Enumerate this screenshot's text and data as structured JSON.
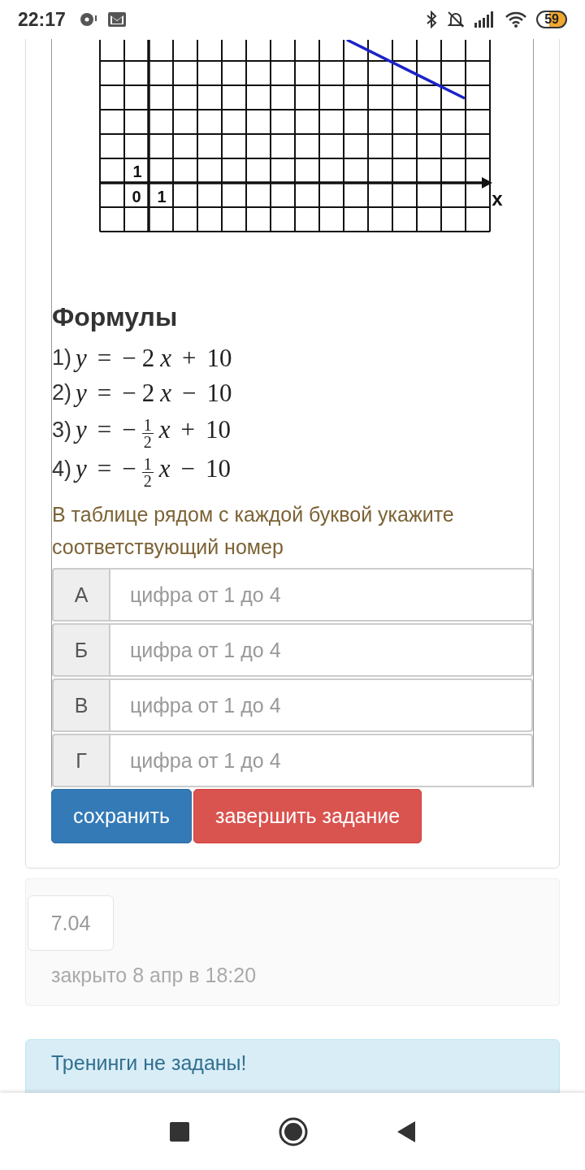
{
  "status_bar": {
    "time": "22:17",
    "battery": "59"
  },
  "graph": {
    "labels": [
      {
        "kind": "y_unit",
        "text": "1"
      },
      {
        "kind": "origin",
        "text": "0"
      },
      {
        "kind": "x_unit",
        "text": "1"
      },
      {
        "kind": "x_axis",
        "text": "x"
      }
    ]
  },
  "heading": "Формулы",
  "formulas": [
    {
      "label": "1)",
      "lhs": "y",
      "relation": "=",
      "kind": "integer",
      "sign": "−",
      "coef": "2",
      "variable": "x",
      "op": "+",
      "constant": "10"
    },
    {
      "label": "2)",
      "lhs": "y",
      "relation": "=",
      "kind": "integer",
      "sign": "−",
      "coef": "2",
      "variable": "x",
      "op": "−",
      "constant": "10"
    },
    {
      "label": "3)",
      "lhs": "y",
      "relation": "=",
      "kind": "fraction",
      "sign": "−",
      "numerator": "1",
      "denominator": "2",
      "variable": "x",
      "op": "+",
      "constant": "10"
    },
    {
      "label": "4)",
      "lhs": "y",
      "relation": "=",
      "kind": "fraction",
      "sign": "−",
      "numerator": "1",
      "denominator": "2",
      "variable": "x",
      "op": "−",
      "constant": "10"
    }
  ],
  "instruction": "В таблице рядом с каждой буквой укажите соответствующий номер",
  "answers": [
    {
      "letter": "А",
      "placeholder": "цифра от 1 до 4"
    },
    {
      "letter": "Б",
      "placeholder": "цифра от 1 до 4"
    },
    {
      "letter": "В",
      "placeholder": "цифра от 1 до 4"
    },
    {
      "letter": "Г",
      "placeholder": "цифра от 1 до 4"
    }
  ],
  "buttons": [
    {
      "kind": "primary",
      "label": "сохранить"
    },
    {
      "kind": "danger",
      "label": "завершить задание"
    }
  ],
  "task": {
    "badge": "7.04",
    "status": "закрыто 8 апр в 18:20"
  },
  "alert": "Тренинги не заданы!"
}
